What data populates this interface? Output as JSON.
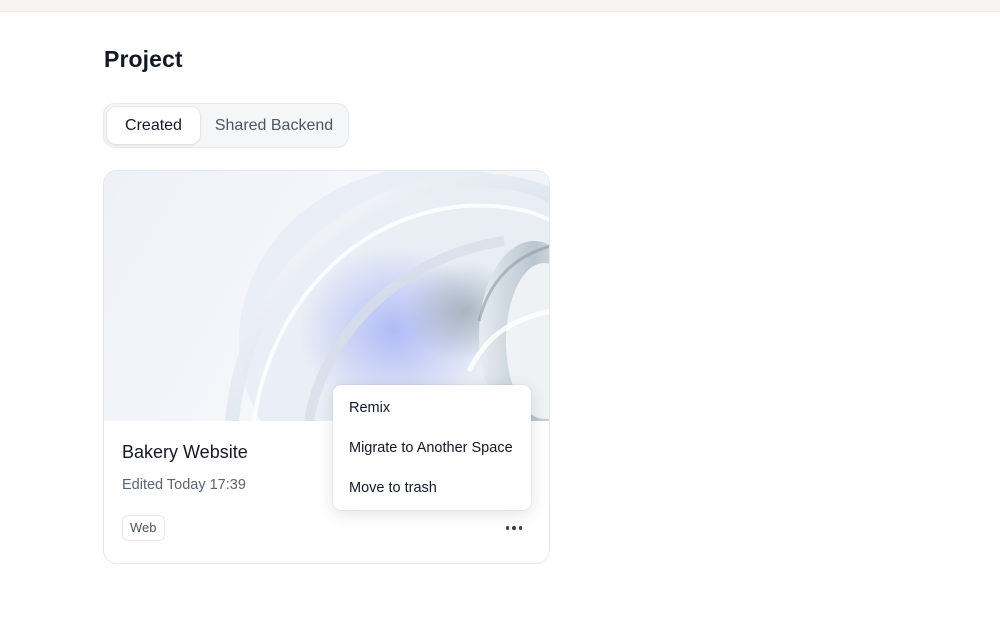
{
  "page": {
    "title": "Project"
  },
  "tabs": [
    {
      "label": "Created",
      "active": true
    },
    {
      "label": "Shared Backend",
      "active": false
    }
  ],
  "project_card": {
    "title": "Bakery Website",
    "edited": "Edited Today 17:39",
    "tag": "Web",
    "more_icon": "ellipsis-icon"
  },
  "context_menu": {
    "items": [
      {
        "label": "Remix"
      },
      {
        "label": "Migrate to Another Space"
      },
      {
        "label": "Move to trash"
      }
    ]
  },
  "colors": {
    "accent_blue": "#a9b8f5",
    "text_primary": "#141821",
    "text_secondary": "#5b6270",
    "border": "#e5e7eb"
  }
}
